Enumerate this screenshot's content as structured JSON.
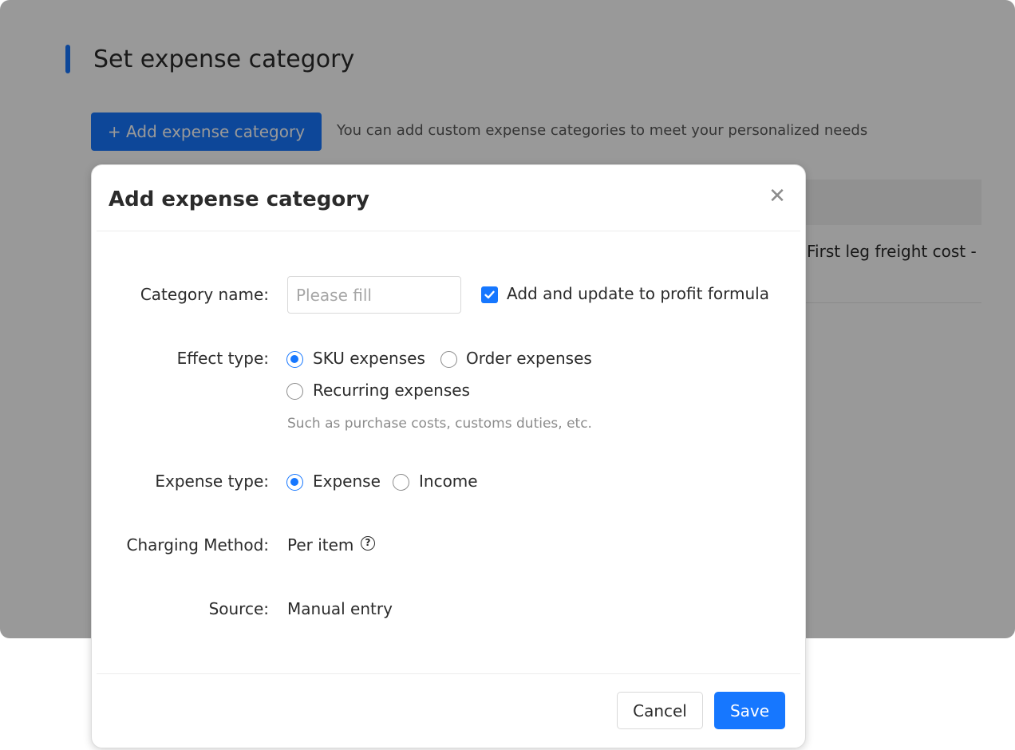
{
  "page": {
    "title": "Set expense category",
    "add_button_label": "+ Add expense category",
    "hint": "You can add custom expense categories to meet your personalized needs",
    "table_cell_text": "First leg freight cost -"
  },
  "modal": {
    "title": "Add expense category",
    "close_glyph": "✕",
    "category_name": {
      "label": "Category name:",
      "value": "",
      "placeholder": "Please fill"
    },
    "profit_formula": {
      "label": "Add and update to profit formula",
      "checked": true
    },
    "effect_type": {
      "label": "Effect type:",
      "options": [
        "SKU expenses",
        "Order expenses",
        "Recurring expenses"
      ],
      "selected": "SKU expenses",
      "help": "Such as purchase costs, customs duties, etc."
    },
    "expense_type": {
      "label": "Expense type:",
      "options": [
        "Expense",
        "Income"
      ],
      "selected": "Expense"
    },
    "charging_method": {
      "label": "Charging Method:",
      "value": "Per item",
      "help_icon": "?"
    },
    "source": {
      "label": "Source:",
      "value": "Manual entry"
    },
    "cancel_label": "Cancel",
    "save_label": "Save"
  },
  "colors": {
    "accent": "#1677ff",
    "mask": "rgba(0,0,0,0.40)"
  }
}
